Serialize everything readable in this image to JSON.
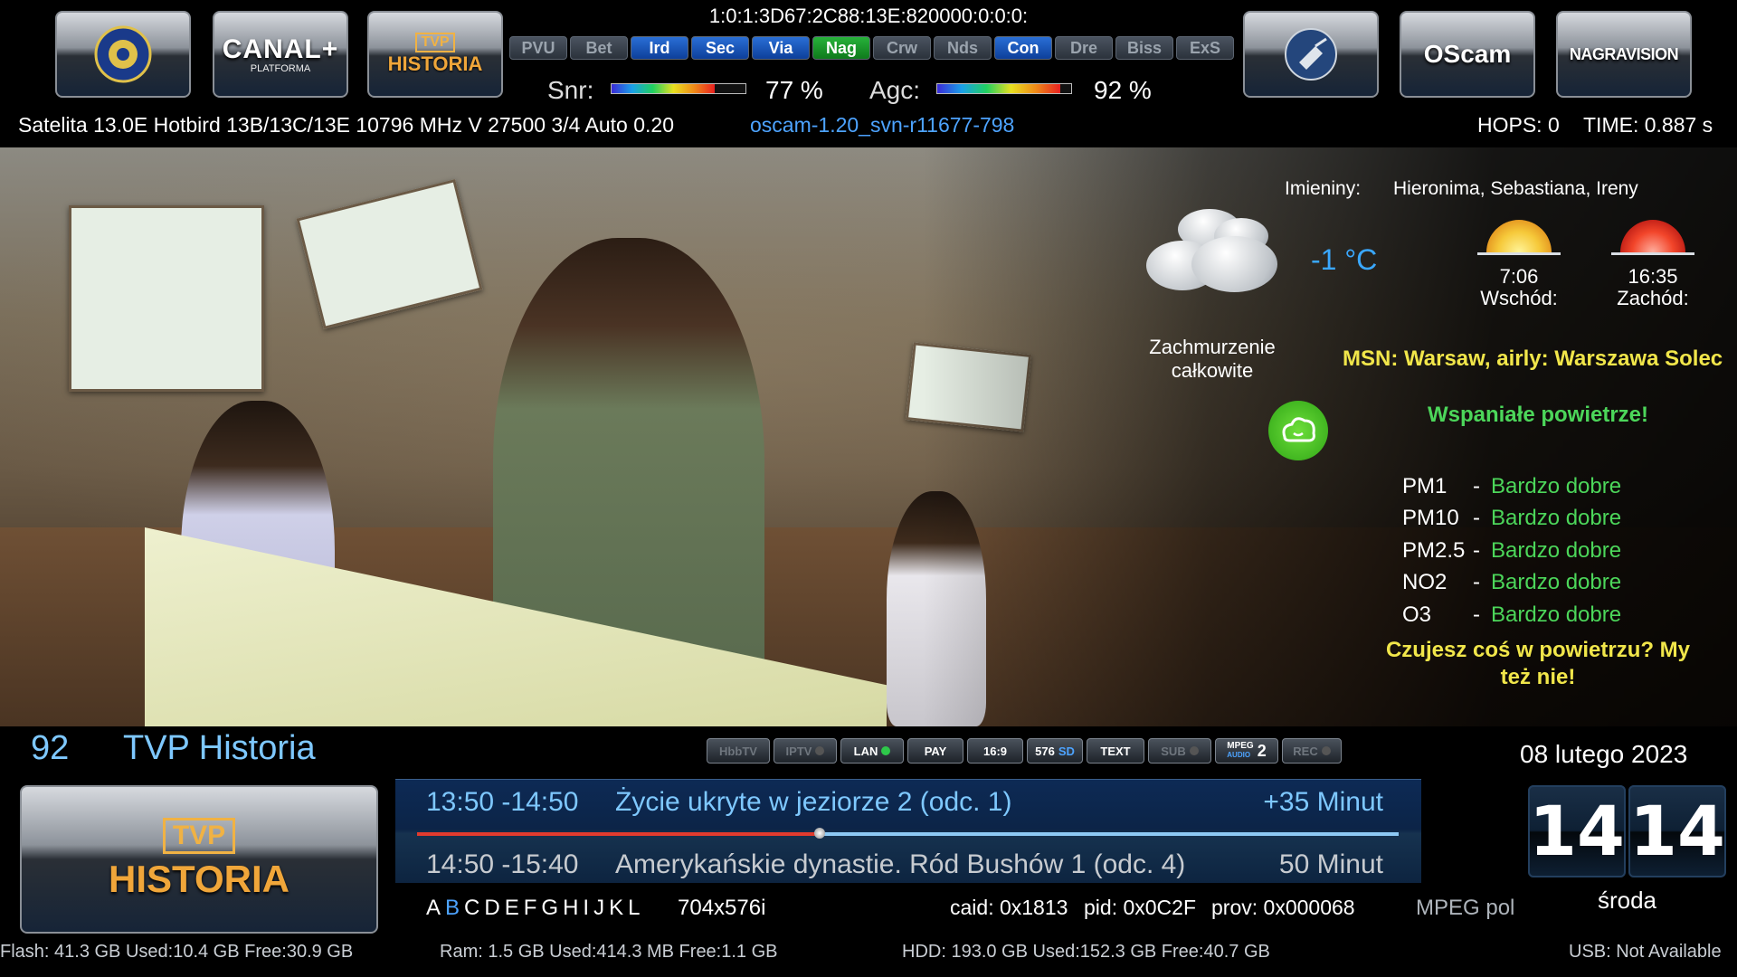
{
  "top": {
    "service_ref": "1:0:1:3D67:2C88:13E:820000:0:0:0:",
    "logos": {
      "left": [
        "DVB-T",
        "CANAL+",
        "TVP HISTORIA"
      ],
      "canal_sub": "PLATFORMA",
      "tvp_badge": "TVP",
      "tvp_word": "HISTORIA",
      "right": [
        "DVB-S2",
        "OScam",
        "NAGRAVISION"
      ]
    },
    "ecm_systems": [
      {
        "label": "PVU",
        "state": "off"
      },
      {
        "label": "Bet",
        "state": "off"
      },
      {
        "label": "Ird",
        "state": "blue"
      },
      {
        "label": "Sec",
        "state": "blue"
      },
      {
        "label": "Via",
        "state": "blue"
      },
      {
        "label": "Nag",
        "state": "green"
      },
      {
        "label": "Crw",
        "state": "off"
      },
      {
        "label": "Nds",
        "state": "off"
      },
      {
        "label": "Con",
        "state": "blue"
      },
      {
        "label": "Dre",
        "state": "off"
      },
      {
        "label": "Biss",
        "state": "off"
      },
      {
        "label": "ExS",
        "state": "off"
      }
    ],
    "snr_label": "Snr:",
    "snr_value": "77 %",
    "snr_level": 0.77,
    "agc_label": "Agc:",
    "agc_value": "92 %",
    "agc_level": 0.92,
    "tuner_info": "Satelita 13.0E Hotbird 13B/13C/13E 10796 MHz V 27500 3/4  Auto 0.20",
    "cam_version": "oscam-1.20_svn-r11677-798",
    "hops": "HOPS: 0",
    "time": "TIME: 0.887 s"
  },
  "weather": {
    "name_day_label": "Imieniny:",
    "name_day_value": "Hieronima, Sebastiana, Ireny",
    "temperature": "-1 °C",
    "condition_line1": "Zachmurzenie",
    "condition_line2": "całkowite",
    "sunrise_time": "7:06",
    "sunrise_label": "Wschód:",
    "sunset_time": "16:35",
    "sunset_label": "Zachód:",
    "station": "MSN: Warsaw, airly: Warszawa Solec",
    "air_headline": "Wspaniałe powietrze!",
    "pollutants": [
      {
        "name": "PM1",
        "sep": "-",
        "status": "Bardzo dobre"
      },
      {
        "name": "PM10",
        "sep": "-",
        "status": "Bardzo dobre"
      },
      {
        "name": "PM2.5",
        "sep": "-",
        "status": "Bardzo dobre"
      },
      {
        "name": "NO2",
        "sep": "-",
        "status": "Bardzo dobre"
      },
      {
        "name": "O3",
        "sep": "-",
        "status": "Bardzo dobre"
      }
    ],
    "air_footer_line1": "Czujesz coś w powietrzu? My",
    "air_footer_line2": "też nie!"
  },
  "channel": {
    "number": "92",
    "name": "TVP Historia",
    "date": "08 lutego 2023",
    "clock_hour": "14",
    "clock_minute": "14",
    "weekday": "środa"
  },
  "flags": [
    {
      "label": "HbbTV",
      "state": "off"
    },
    {
      "label": "IPTV",
      "state": "off"
    },
    {
      "label": "LAN",
      "state": "on"
    },
    {
      "label": "PAY",
      "state": "on"
    },
    {
      "label": "16:9",
      "state": "on"
    },
    {
      "label": "576",
      "state": "on",
      "extra": "SD"
    },
    {
      "label": "TEXT",
      "state": "on"
    },
    {
      "label": "SUB",
      "state": "off"
    },
    {
      "label": "MPEG",
      "state": "on",
      "sub": "AUDIO",
      "extra": "2"
    },
    {
      "label": "REC",
      "state": "off"
    }
  ],
  "epg": {
    "now_time": "13:50 -14:50",
    "now_title": "Życie ukryte w jeziorze 2 (odc. 1)",
    "now_remaining": "+35 Minut",
    "now_progress": 0.41,
    "next_time": "14:50  -15:40",
    "next_title": "Amerykańskie dynastie. Ród Bushów 1 (odc. 4)",
    "next_duration": "50 Minut"
  },
  "info": {
    "abc_line": [
      "A",
      "B",
      "C",
      "D",
      "E",
      "F",
      "G",
      "H",
      "I",
      "J",
      "K",
      "L"
    ],
    "abc_active_index": 1,
    "resolution": "704x576i",
    "caid": "caid: 0x1813",
    "pid": "pid: 0x0C2F",
    "prov": "prov: 0x000068",
    "audio": "MPEG pol"
  },
  "footer": {
    "flash": "Flash: 41.3 GB Used:10.4 GB Free:30.9 GB",
    "ram": "Ram: 1.5 GB Used:414.3 MB Free:1.1 GB",
    "hdd": "HDD: 193.0 GB Used:152.3 GB Free:40.7 GB",
    "usb": "USB: Not Available"
  },
  "colors": {
    "ecm_active_blue": "#1553c4",
    "ecm_active_green": "#1d9a2c",
    "epg_now_text": "#7ec8ff",
    "air_good": "#4cd65a",
    "station_yellow": "#f1e64a",
    "temperature_blue": "#3aa8ff",
    "progress_red": "#e23b2e"
  }
}
